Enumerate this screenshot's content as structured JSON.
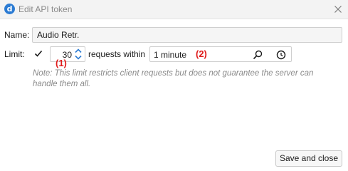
{
  "window": {
    "title": "Edit API token",
    "app_icon_letter": "d",
    "close_icon": "close-icon"
  },
  "form": {
    "name_label": "Name:",
    "name_value": "Audio Retr.",
    "limit_label": "Limit:",
    "limit_enabled": true,
    "requests_count": "30",
    "requests_within_label": "requests within",
    "interval_value": "1 minute",
    "note": "Note: This limit restricts client requests but does not guarantee the server can handle them all."
  },
  "annotations": {
    "marker_1": "(1)",
    "marker_2": "(2)",
    "color": "#e01b1b"
  },
  "footer": {
    "save_label": "Save and close"
  },
  "colors": {
    "accent": "#2b7bd3",
    "muted_text": "#8a8a8a"
  }
}
